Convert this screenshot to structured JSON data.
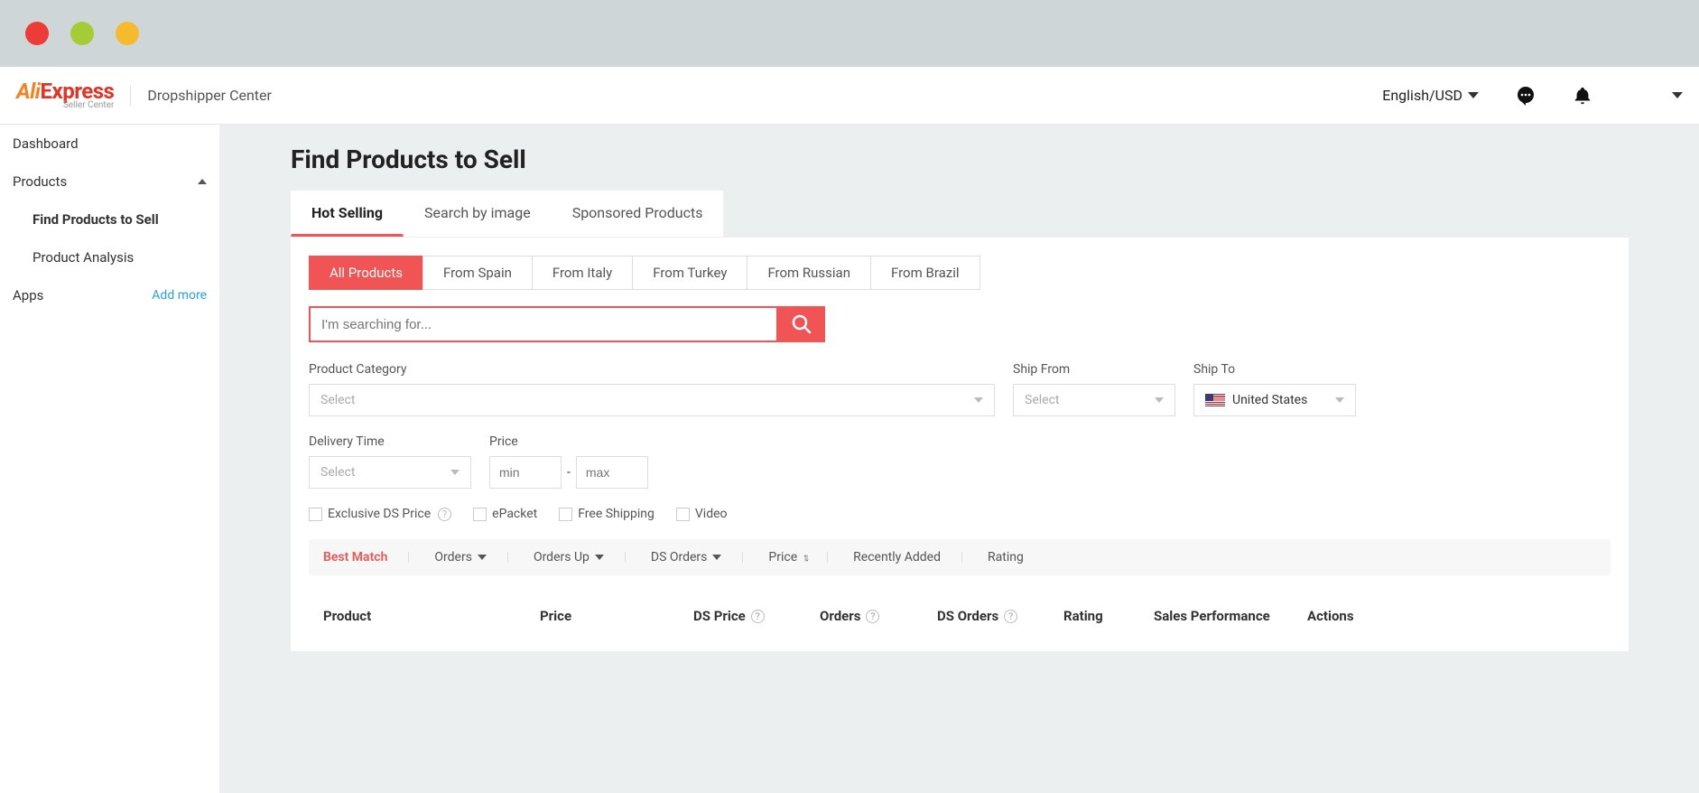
{
  "header": {
    "logo_primary": "AliExpress",
    "logo_sub": "Seller Center",
    "title": "Dropshipper Center",
    "language": "English/USD"
  },
  "sidebar": {
    "items": [
      {
        "label": "Dashboard"
      },
      {
        "label": "Products",
        "expanded": true,
        "children": [
          {
            "label": "Find Products to Sell",
            "active": true
          },
          {
            "label": "Product Analysis"
          }
        ]
      },
      {
        "label": "Apps",
        "action": "Add more"
      }
    ]
  },
  "page": {
    "title": "Find Products to Sell",
    "tabs": [
      "Hot Selling",
      "Search by image",
      "Sponsored Products"
    ],
    "active_tab": 0,
    "source_tabs": [
      "All Products",
      "From Spain",
      "From Italy",
      "From Turkey",
      "From Russian",
      "From Brazil"
    ],
    "active_source": 0,
    "search_placeholder": "I'm searching for...",
    "filters": {
      "category_label": "Product Category",
      "category_placeholder": "Select",
      "shipfrom_label": "Ship From",
      "shipfrom_placeholder": "Select",
      "shipto_label": "Ship To",
      "shipto_value": "United States",
      "delivery_label": "Delivery Time",
      "delivery_placeholder": "Select",
      "price_label": "Price",
      "price_min_placeholder": "min",
      "price_max_placeholder": "max"
    },
    "checkboxes": {
      "exclusive": "Exclusive DS Price",
      "epacket": "ePacket",
      "freeship": "Free Shipping",
      "video": "Video"
    },
    "sort": {
      "best_match": "Best Match",
      "orders": "Orders",
      "orders_up": "Orders Up",
      "ds_orders": "DS Orders",
      "price": "Price",
      "recently": "Recently Added",
      "rating": "Rating"
    },
    "table_headers": {
      "product": "Product",
      "price": "Price",
      "ds_price": "DS Price",
      "orders": "Orders",
      "ds_orders": "DS Orders",
      "rating": "Rating",
      "sales_perf": "Sales Performance",
      "actions": "Actions"
    }
  }
}
